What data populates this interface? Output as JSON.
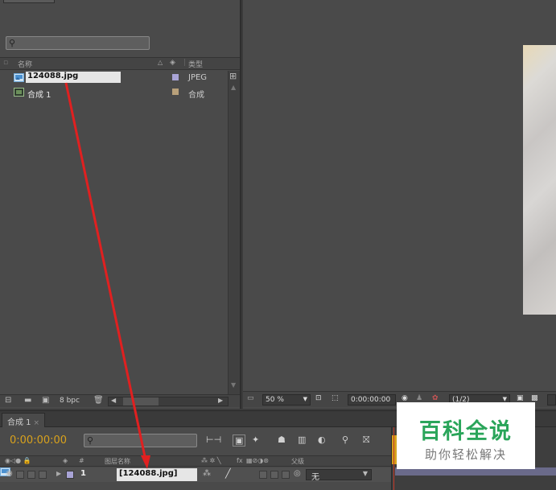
{
  "project": {
    "search_placeholder": "",
    "columns": {
      "name": "名称",
      "type": "类型"
    },
    "items": [
      {
        "name": "124088.jpg",
        "type": "JPEG",
        "swatch": "#a9a4d6",
        "icon": "image-file-icon"
      },
      {
        "name": "合成 1",
        "type": "合成",
        "swatch": "#b8a07a",
        "icon": "composition-icon"
      }
    ],
    "footer": {
      "bpc": "8 bpc"
    }
  },
  "viewer": {
    "zoom": "50 %",
    "timecode": "0:00:00:00",
    "resolution": "(1/2)"
  },
  "timeline": {
    "tab_label": "合成 1",
    "timecode": "0:00:00:00",
    "search_placeholder": "",
    "header": {
      "num": "#",
      "layer_name": "图层名称",
      "fx": "fx",
      "parent": "父级"
    },
    "layer": {
      "index": "1",
      "name": "[124088.jpg]",
      "parent": "无",
      "label_color": "#a9a4d6"
    }
  },
  "watermark": {
    "title": "百科全说",
    "subtitle": "助你轻松解决"
  },
  "colors": {
    "timecode": "#d9a21c",
    "arrow": "#e02020",
    "watermark_green": "#2aa55a"
  }
}
